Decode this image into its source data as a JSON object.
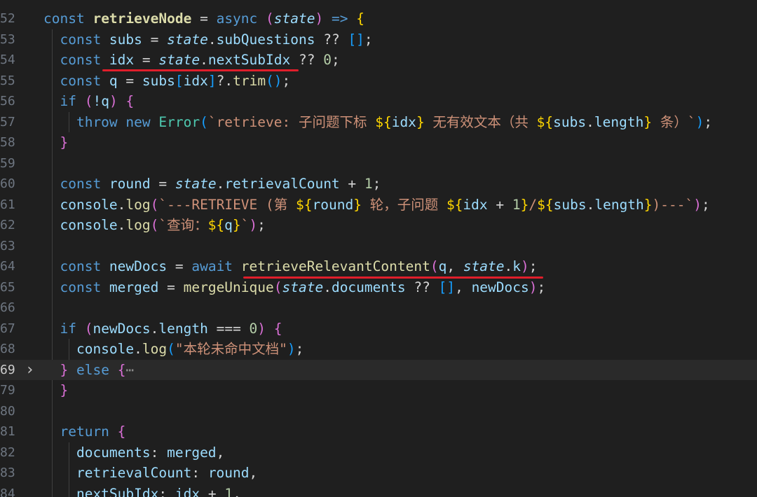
{
  "editor": {
    "colors": {
      "background": "#1f1f1f",
      "keyword": "#569cd6",
      "function": "#dcdcaa",
      "variable": "#9cdcfe",
      "string": "#ce9178",
      "number": "#b5cea8",
      "bracket_gold": "#ffd700",
      "bracket_purple": "#da70d6",
      "bracket_blue": "#179fff",
      "underline": "#e01e2b"
    },
    "fold_icon": "chevron-right-icon",
    "lines": [
      {
        "num": "52",
        "tokens": [
          {
            "t": "const ",
            "c": "kw"
          },
          {
            "t": "retrieveNode",
            "c": "fnb"
          },
          {
            "t": " = ",
            "c": "op"
          },
          {
            "t": "async",
            "c": "kw"
          },
          {
            "t": " ",
            "c": "op"
          },
          {
            "t": "(",
            "c": "b2"
          },
          {
            "t": "state",
            "c": "par"
          },
          {
            "t": ")",
            "c": "b2"
          },
          {
            "t": " => ",
            "c": "kw"
          },
          {
            "t": "{",
            "c": "b1"
          }
        ]
      },
      {
        "num": "53",
        "tokens": [
          {
            "t": "  const ",
            "c": "kw"
          },
          {
            "t": "subs",
            "c": "var"
          },
          {
            "t": " = ",
            "c": "op"
          },
          {
            "t": "state",
            "c": "par"
          },
          {
            "t": ".",
            "c": "op"
          },
          {
            "t": "subQuestions",
            "c": "prop"
          },
          {
            "t": " ?? ",
            "c": "op"
          },
          {
            "t": "[]",
            "c": "b3"
          },
          {
            "t": ";",
            "c": "op"
          }
        ]
      },
      {
        "num": "54",
        "tokens": [
          {
            "t": "  const ",
            "c": "kw"
          },
          {
            "t": "idx",
            "c": "var"
          },
          {
            "t": " = ",
            "c": "op"
          },
          {
            "t": "state",
            "c": "par"
          },
          {
            "t": ".",
            "c": "op"
          },
          {
            "t": "nextSubIdx",
            "c": "prop"
          },
          {
            "t": " ?? ",
            "c": "op"
          },
          {
            "t": "0",
            "c": "num"
          },
          {
            "t": ";",
            "c": "op"
          }
        ]
      },
      {
        "num": "55",
        "tokens": [
          {
            "t": "  const ",
            "c": "kw"
          },
          {
            "t": "q",
            "c": "var"
          },
          {
            "t": " = ",
            "c": "op"
          },
          {
            "t": "subs",
            "c": "var"
          },
          {
            "t": "[",
            "c": "b3"
          },
          {
            "t": "idx",
            "c": "var"
          },
          {
            "t": "]",
            "c": "b3"
          },
          {
            "t": "?.",
            "c": "op"
          },
          {
            "t": "trim",
            "c": "fn"
          },
          {
            "t": "()",
            "c": "b3"
          },
          {
            "t": ";",
            "c": "op"
          }
        ]
      },
      {
        "num": "56",
        "tokens": [
          {
            "t": "  if ",
            "c": "kw"
          },
          {
            "t": "(",
            "c": "b2"
          },
          {
            "t": "!q",
            "c": "var"
          },
          {
            "t": ")",
            "c": "b2"
          },
          {
            "t": " ",
            "c": "op"
          },
          {
            "t": "{",
            "c": "b2"
          }
        ]
      },
      {
        "num": "57",
        "tokens": [
          {
            "t": "    throw new ",
            "c": "kw"
          },
          {
            "t": "Error",
            "c": "cls"
          },
          {
            "t": "(",
            "c": "b3"
          },
          {
            "t": "`retrieve: 子问题下标 ",
            "c": "str"
          },
          {
            "t": "${",
            "c": "b1"
          },
          {
            "t": "idx",
            "c": "var"
          },
          {
            "t": "}",
            "c": "b1"
          },
          {
            "t": " 无有效文本（共 ",
            "c": "str"
          },
          {
            "t": "${",
            "c": "b1"
          },
          {
            "t": "subs",
            "c": "var"
          },
          {
            "t": ".",
            "c": "op"
          },
          {
            "t": "length",
            "c": "prop"
          },
          {
            "t": "}",
            "c": "b1"
          },
          {
            "t": " 条）`",
            "c": "str"
          },
          {
            "t": ")",
            "c": "b3"
          },
          {
            "t": ";",
            "c": "op"
          }
        ]
      },
      {
        "num": "58",
        "tokens": [
          {
            "t": "  ",
            "c": "op"
          },
          {
            "t": "}",
            "c": "b2"
          }
        ]
      },
      {
        "num": "59",
        "tokens": []
      },
      {
        "num": "60",
        "tokens": [
          {
            "t": "  const ",
            "c": "kw"
          },
          {
            "t": "round",
            "c": "var"
          },
          {
            "t": " = ",
            "c": "op"
          },
          {
            "t": "state",
            "c": "par"
          },
          {
            "t": ".",
            "c": "op"
          },
          {
            "t": "retrievalCount",
            "c": "prop"
          },
          {
            "t": " + ",
            "c": "op"
          },
          {
            "t": "1",
            "c": "num"
          },
          {
            "t": ";",
            "c": "op"
          }
        ]
      },
      {
        "num": "61",
        "tokens": [
          {
            "t": "  console",
            "c": "var"
          },
          {
            "t": ".",
            "c": "op"
          },
          {
            "t": "log",
            "c": "fn"
          },
          {
            "t": "(",
            "c": "b2"
          },
          {
            "t": "`---RETRIEVE (第 ",
            "c": "str"
          },
          {
            "t": "${",
            "c": "b1"
          },
          {
            "t": "round",
            "c": "var"
          },
          {
            "t": "}",
            "c": "b1"
          },
          {
            "t": " 轮，子问题 ",
            "c": "str"
          },
          {
            "t": "${",
            "c": "b1"
          },
          {
            "t": "idx",
            "c": "var"
          },
          {
            "t": " + ",
            "c": "op"
          },
          {
            "t": "1",
            "c": "num"
          },
          {
            "t": "}",
            "c": "b1"
          },
          {
            "t": "/",
            "c": "str"
          },
          {
            "t": "${",
            "c": "b1"
          },
          {
            "t": "subs",
            "c": "var"
          },
          {
            "t": ".",
            "c": "op"
          },
          {
            "t": "length",
            "c": "prop"
          },
          {
            "t": "}",
            "c": "b1"
          },
          {
            "t": ")---`",
            "c": "str"
          },
          {
            "t": ")",
            "c": "b2"
          },
          {
            "t": ";",
            "c": "op"
          }
        ]
      },
      {
        "num": "62",
        "tokens": [
          {
            "t": "  console",
            "c": "var"
          },
          {
            "t": ".",
            "c": "op"
          },
          {
            "t": "log",
            "c": "fn"
          },
          {
            "t": "(",
            "c": "b2"
          },
          {
            "t": "`查询：",
            "c": "str"
          },
          {
            "t": "${",
            "c": "b1"
          },
          {
            "t": "q",
            "c": "var"
          },
          {
            "t": "}",
            "c": "b1"
          },
          {
            "t": "`",
            "c": "str"
          },
          {
            "t": ")",
            "c": "b2"
          },
          {
            "t": ";",
            "c": "op"
          }
        ]
      },
      {
        "num": "63",
        "tokens": []
      },
      {
        "num": "64",
        "tokens": [
          {
            "t": "  const ",
            "c": "kw"
          },
          {
            "t": "newDocs",
            "c": "var"
          },
          {
            "t": " = ",
            "c": "op"
          },
          {
            "t": "await ",
            "c": "kw"
          },
          {
            "t": "retrieveRelevantContent",
            "c": "fn"
          },
          {
            "t": "(",
            "c": "b2"
          },
          {
            "t": "q",
            "c": "var"
          },
          {
            "t": ", ",
            "c": "op"
          },
          {
            "t": "state",
            "c": "par"
          },
          {
            "t": ".",
            "c": "op"
          },
          {
            "t": "k",
            "c": "prop"
          },
          {
            "t": ")",
            "c": "b2"
          },
          {
            "t": ";",
            "c": "op"
          }
        ]
      },
      {
        "num": "65",
        "tokens": [
          {
            "t": "  const ",
            "c": "kw"
          },
          {
            "t": "merged",
            "c": "var"
          },
          {
            "t": " = ",
            "c": "op"
          },
          {
            "t": "mergeUnique",
            "c": "fn"
          },
          {
            "t": "(",
            "c": "b2"
          },
          {
            "t": "state",
            "c": "par"
          },
          {
            "t": ".",
            "c": "op"
          },
          {
            "t": "documents",
            "c": "prop"
          },
          {
            "t": " ?? ",
            "c": "op"
          },
          {
            "t": "[]",
            "c": "b3"
          },
          {
            "t": ", ",
            "c": "op"
          },
          {
            "t": "newDocs",
            "c": "var"
          },
          {
            "t": ")",
            "c": "b2"
          },
          {
            "t": ";",
            "c": "op"
          }
        ]
      },
      {
        "num": "66",
        "tokens": []
      },
      {
        "num": "67",
        "tokens": [
          {
            "t": "  if ",
            "c": "kw"
          },
          {
            "t": "(",
            "c": "b2"
          },
          {
            "t": "newDocs",
            "c": "var"
          },
          {
            "t": ".",
            "c": "op"
          },
          {
            "t": "length",
            "c": "prop"
          },
          {
            "t": " === ",
            "c": "op"
          },
          {
            "t": "0",
            "c": "num"
          },
          {
            "t": ")",
            "c": "b2"
          },
          {
            "t": " ",
            "c": "op"
          },
          {
            "t": "{",
            "c": "b2"
          }
        ]
      },
      {
        "num": "68",
        "tokens": [
          {
            "t": "    console",
            "c": "var"
          },
          {
            "t": ".",
            "c": "op"
          },
          {
            "t": "log",
            "c": "fn"
          },
          {
            "t": "(",
            "c": "b3"
          },
          {
            "t": "\"本轮未命中文档\"",
            "c": "str"
          },
          {
            "t": ")",
            "c": "b3"
          },
          {
            "t": ";",
            "c": "op"
          }
        ]
      },
      {
        "num": "69",
        "current": true,
        "fold": true,
        "tokens": [
          {
            "t": "  ",
            "c": "op"
          },
          {
            "t": "}",
            "c": "b2"
          },
          {
            "t": " else ",
            "c": "kw"
          },
          {
            "t": "{",
            "c": "b2"
          },
          {
            "t": "⋯",
            "c": "dim"
          }
        ]
      },
      {
        "num": "79",
        "tokens": [
          {
            "t": "  ",
            "c": "op"
          },
          {
            "t": "}",
            "c": "b2"
          }
        ]
      },
      {
        "num": "80",
        "tokens": []
      },
      {
        "num": "81",
        "tokens": [
          {
            "t": "  return ",
            "c": "kw"
          },
          {
            "t": "{",
            "c": "b2"
          }
        ]
      },
      {
        "num": "82",
        "tokens": [
          {
            "t": "    documents",
            "c": "prop"
          },
          {
            "t": ": ",
            "c": "op"
          },
          {
            "t": "merged",
            "c": "var"
          },
          {
            "t": ",",
            "c": "op"
          }
        ]
      },
      {
        "num": "83",
        "tokens": [
          {
            "t": "    retrievalCount",
            "c": "prop"
          },
          {
            "t": ": ",
            "c": "op"
          },
          {
            "t": "round",
            "c": "var"
          },
          {
            "t": ",",
            "c": "op"
          }
        ]
      },
      {
        "num": "84",
        "tokens": [
          {
            "t": "    nextSubIdx",
            "c": "prop"
          },
          {
            "t": ": ",
            "c": "op"
          },
          {
            "t": "idx",
            "c": "var"
          },
          {
            "t": " + ",
            "c": "op"
          },
          {
            "t": "1",
            "c": "num"
          },
          {
            "t": ",",
            "c": "op"
          }
        ]
      }
    ]
  }
}
